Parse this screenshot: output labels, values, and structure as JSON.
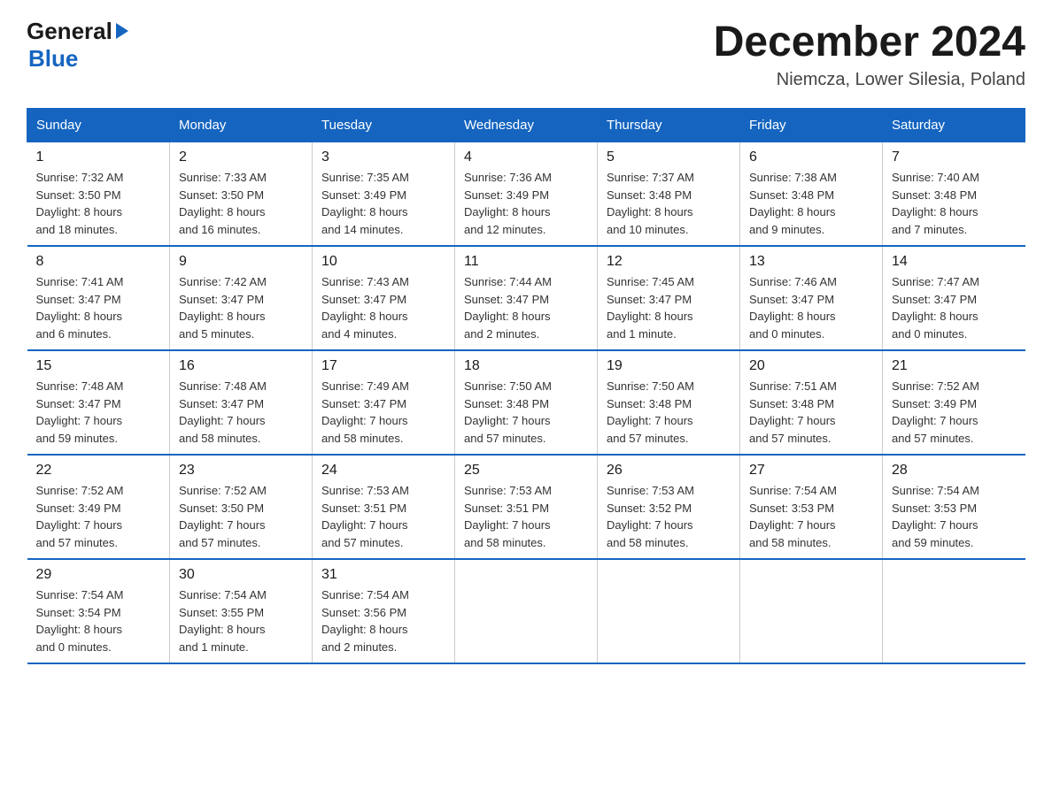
{
  "logo": {
    "general": "General",
    "blue": "Blue"
  },
  "title": "December 2024",
  "location": "Niemcza, Lower Silesia, Poland",
  "days_of_week": [
    "Sunday",
    "Monday",
    "Tuesday",
    "Wednesday",
    "Thursday",
    "Friday",
    "Saturday"
  ],
  "weeks": [
    [
      {
        "day": "1",
        "sunrise": "7:32 AM",
        "sunset": "3:50 PM",
        "daylight": "8 hours and 18 minutes."
      },
      {
        "day": "2",
        "sunrise": "7:33 AM",
        "sunset": "3:50 PM",
        "daylight": "8 hours and 16 minutes."
      },
      {
        "day": "3",
        "sunrise": "7:35 AM",
        "sunset": "3:49 PM",
        "daylight": "8 hours and 14 minutes."
      },
      {
        "day": "4",
        "sunrise": "7:36 AM",
        "sunset": "3:49 PM",
        "daylight": "8 hours and 12 minutes."
      },
      {
        "day": "5",
        "sunrise": "7:37 AM",
        "sunset": "3:48 PM",
        "daylight": "8 hours and 10 minutes."
      },
      {
        "day": "6",
        "sunrise": "7:38 AM",
        "sunset": "3:48 PM",
        "daylight": "8 hours and 9 minutes."
      },
      {
        "day": "7",
        "sunrise": "7:40 AM",
        "sunset": "3:48 PM",
        "daylight": "8 hours and 7 minutes."
      }
    ],
    [
      {
        "day": "8",
        "sunrise": "7:41 AM",
        "sunset": "3:47 PM",
        "daylight": "8 hours and 6 minutes."
      },
      {
        "day": "9",
        "sunrise": "7:42 AM",
        "sunset": "3:47 PM",
        "daylight": "8 hours and 5 minutes."
      },
      {
        "day": "10",
        "sunrise": "7:43 AM",
        "sunset": "3:47 PM",
        "daylight": "8 hours and 4 minutes."
      },
      {
        "day": "11",
        "sunrise": "7:44 AM",
        "sunset": "3:47 PM",
        "daylight": "8 hours and 2 minutes."
      },
      {
        "day": "12",
        "sunrise": "7:45 AM",
        "sunset": "3:47 PM",
        "daylight": "8 hours and 1 minute."
      },
      {
        "day": "13",
        "sunrise": "7:46 AM",
        "sunset": "3:47 PM",
        "daylight": "8 hours and 0 minutes."
      },
      {
        "day": "14",
        "sunrise": "7:47 AM",
        "sunset": "3:47 PM",
        "daylight": "8 hours and 0 minutes."
      }
    ],
    [
      {
        "day": "15",
        "sunrise": "7:48 AM",
        "sunset": "3:47 PM",
        "daylight": "7 hours and 59 minutes."
      },
      {
        "day": "16",
        "sunrise": "7:48 AM",
        "sunset": "3:47 PM",
        "daylight": "7 hours and 58 minutes."
      },
      {
        "day": "17",
        "sunrise": "7:49 AM",
        "sunset": "3:47 PM",
        "daylight": "7 hours and 58 minutes."
      },
      {
        "day": "18",
        "sunrise": "7:50 AM",
        "sunset": "3:48 PM",
        "daylight": "7 hours and 57 minutes."
      },
      {
        "day": "19",
        "sunrise": "7:50 AM",
        "sunset": "3:48 PM",
        "daylight": "7 hours and 57 minutes."
      },
      {
        "day": "20",
        "sunrise": "7:51 AM",
        "sunset": "3:48 PM",
        "daylight": "7 hours and 57 minutes."
      },
      {
        "day": "21",
        "sunrise": "7:52 AM",
        "sunset": "3:49 PM",
        "daylight": "7 hours and 57 minutes."
      }
    ],
    [
      {
        "day": "22",
        "sunrise": "7:52 AM",
        "sunset": "3:49 PM",
        "daylight": "7 hours and 57 minutes."
      },
      {
        "day": "23",
        "sunrise": "7:52 AM",
        "sunset": "3:50 PM",
        "daylight": "7 hours and 57 minutes."
      },
      {
        "day": "24",
        "sunrise": "7:53 AM",
        "sunset": "3:51 PM",
        "daylight": "7 hours and 57 minutes."
      },
      {
        "day": "25",
        "sunrise": "7:53 AM",
        "sunset": "3:51 PM",
        "daylight": "7 hours and 58 minutes."
      },
      {
        "day": "26",
        "sunrise": "7:53 AM",
        "sunset": "3:52 PM",
        "daylight": "7 hours and 58 minutes."
      },
      {
        "day": "27",
        "sunrise": "7:54 AM",
        "sunset": "3:53 PM",
        "daylight": "7 hours and 58 minutes."
      },
      {
        "day": "28",
        "sunrise": "7:54 AM",
        "sunset": "3:53 PM",
        "daylight": "7 hours and 59 minutes."
      }
    ],
    [
      {
        "day": "29",
        "sunrise": "7:54 AM",
        "sunset": "3:54 PM",
        "daylight": "8 hours and 0 minutes."
      },
      {
        "day": "30",
        "sunrise": "7:54 AM",
        "sunset": "3:55 PM",
        "daylight": "8 hours and 1 minute."
      },
      {
        "day": "31",
        "sunrise": "7:54 AM",
        "sunset": "3:56 PM",
        "daylight": "8 hours and 2 minutes."
      },
      null,
      null,
      null,
      null
    ]
  ],
  "labels": {
    "sunrise": "Sunrise:",
    "sunset": "Sunset:",
    "daylight": "Daylight:"
  }
}
